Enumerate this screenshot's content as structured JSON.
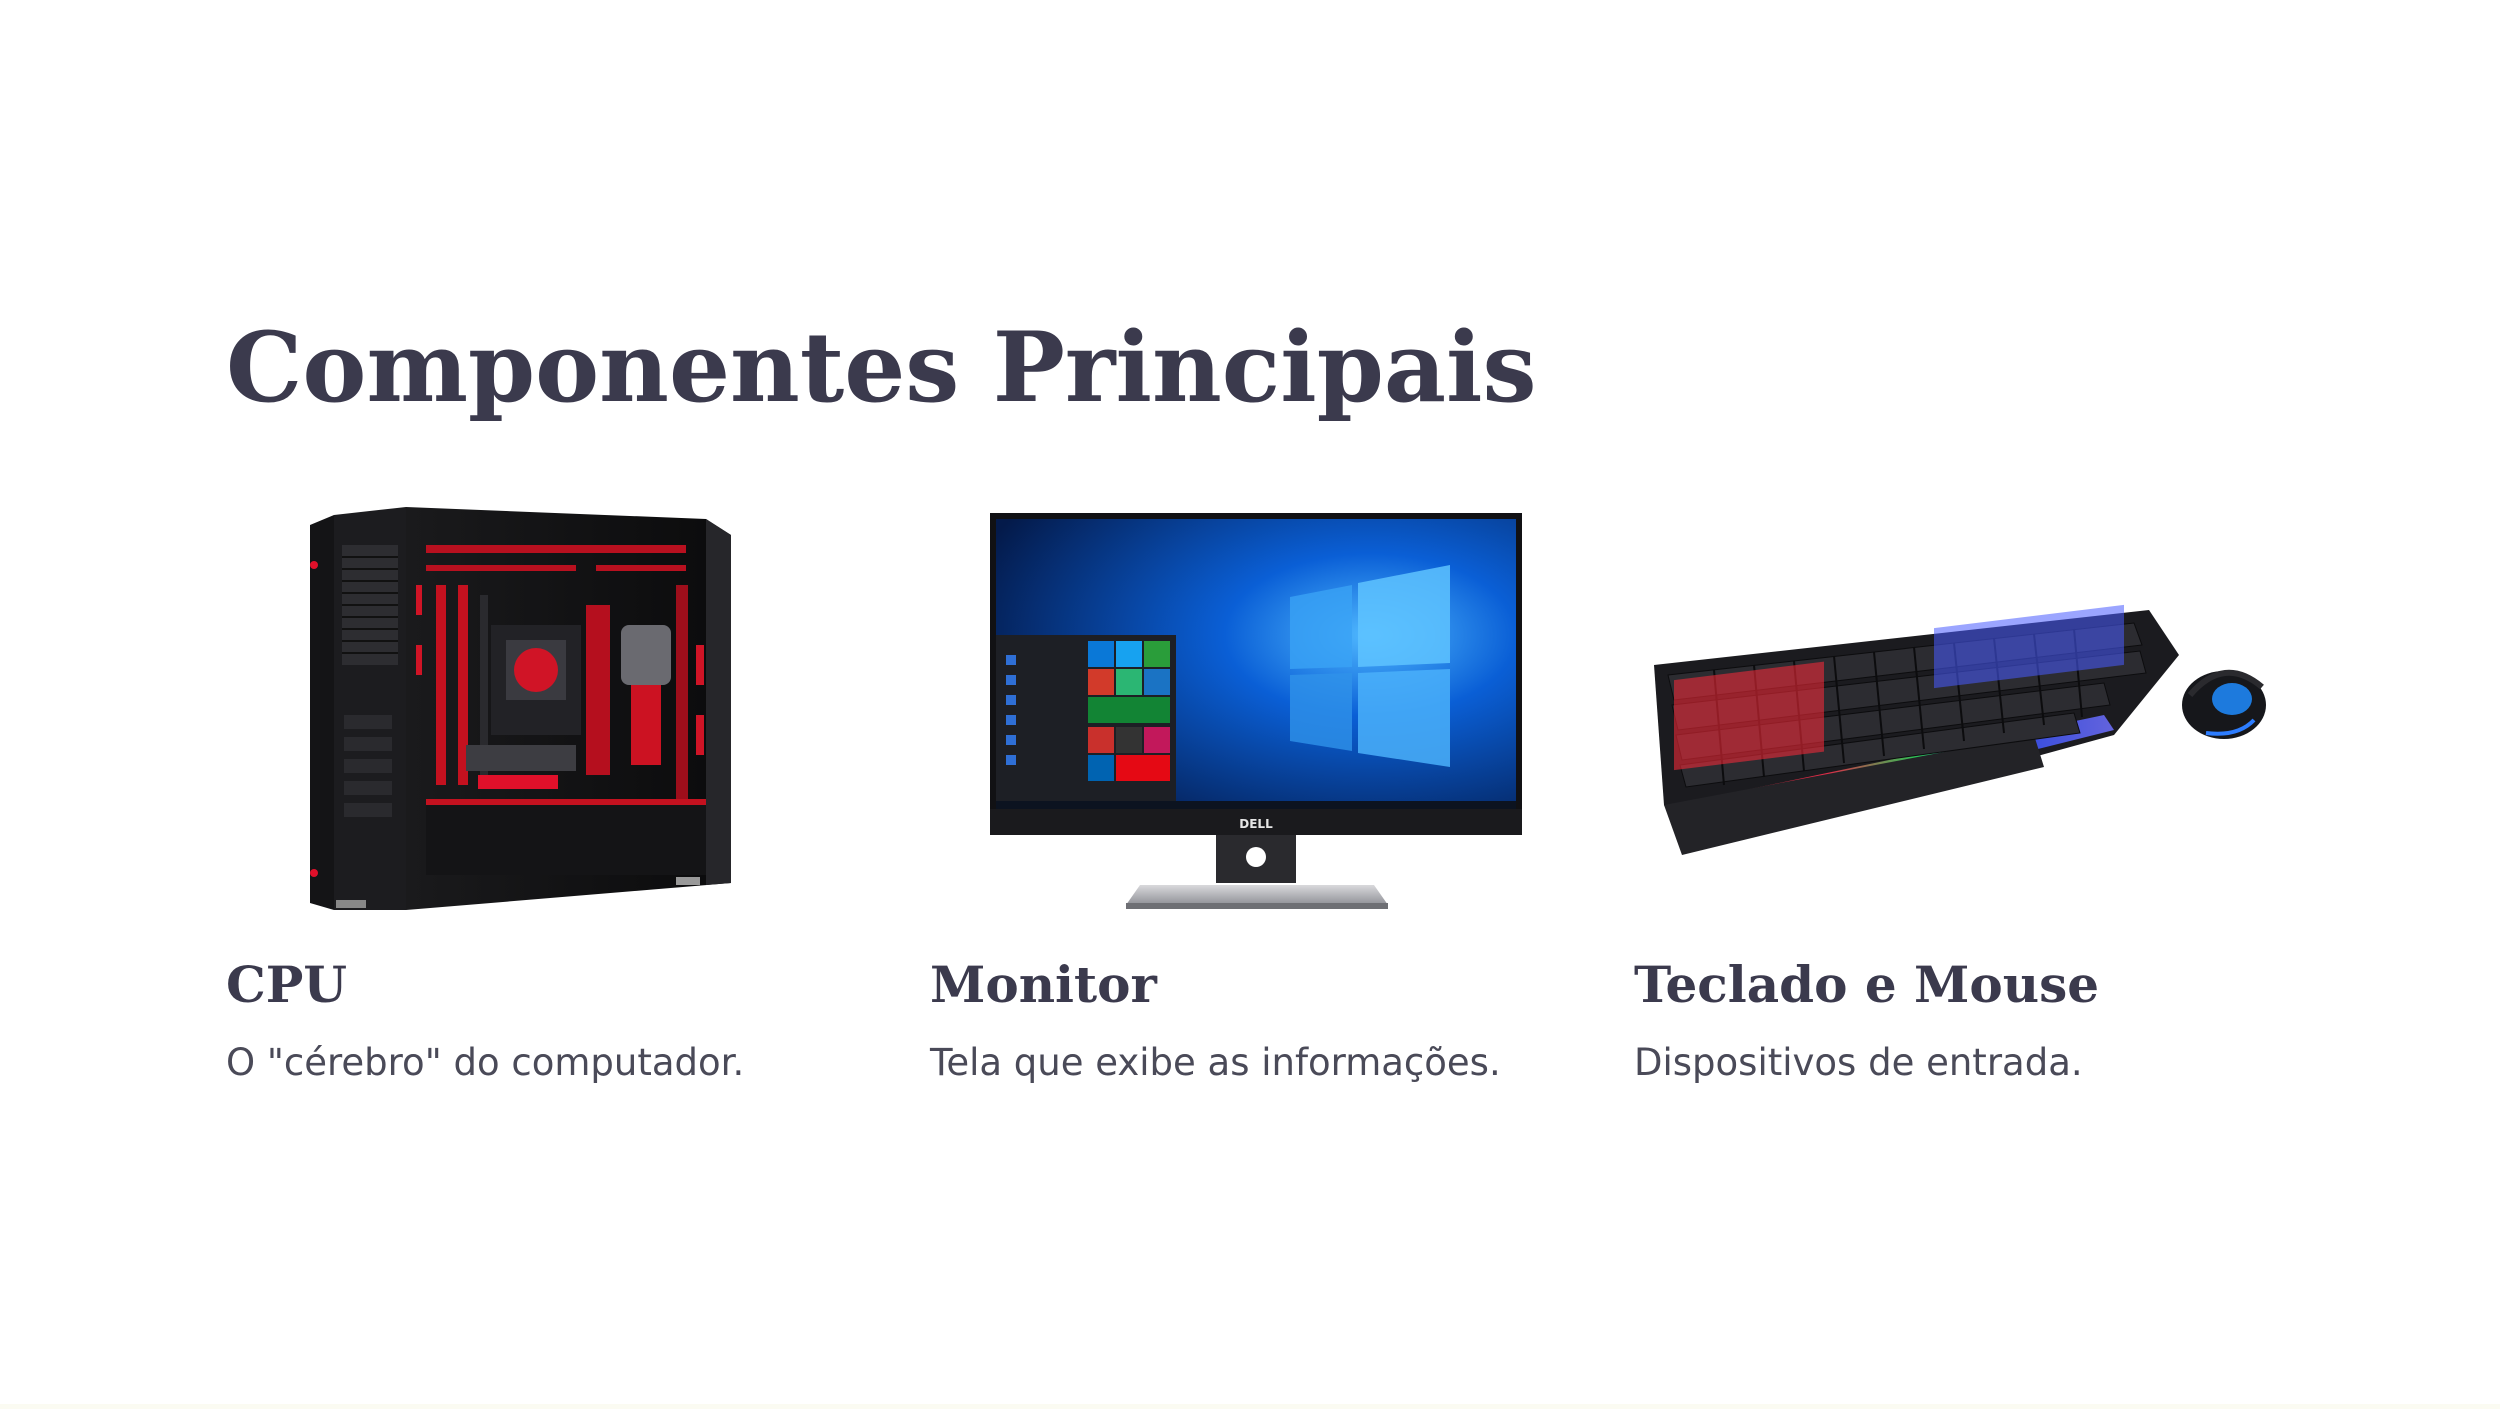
{
  "slide": {
    "title": "Componentes Principais"
  },
  "cards": [
    {
      "title": "CPU",
      "description": "O \"cérebro\" do computador.",
      "image": "desktop-tower-case-photo"
    },
    {
      "title": "Monitor",
      "description": "Tela que exibe as informações.",
      "image": "monitor-photo",
      "brand": "DELL"
    },
    {
      "title": "Teclado e Mouse",
      "description": "Dispositivos de entrada.",
      "image": "rgb-keyboard-and-mouse-photo"
    }
  ],
  "colors": {
    "text": "#3b3a4d",
    "body_text": "#4a4a58",
    "background": "#ffffff",
    "accent_red": "#e0102a",
    "screen_blue": "#0a5fd6"
  }
}
